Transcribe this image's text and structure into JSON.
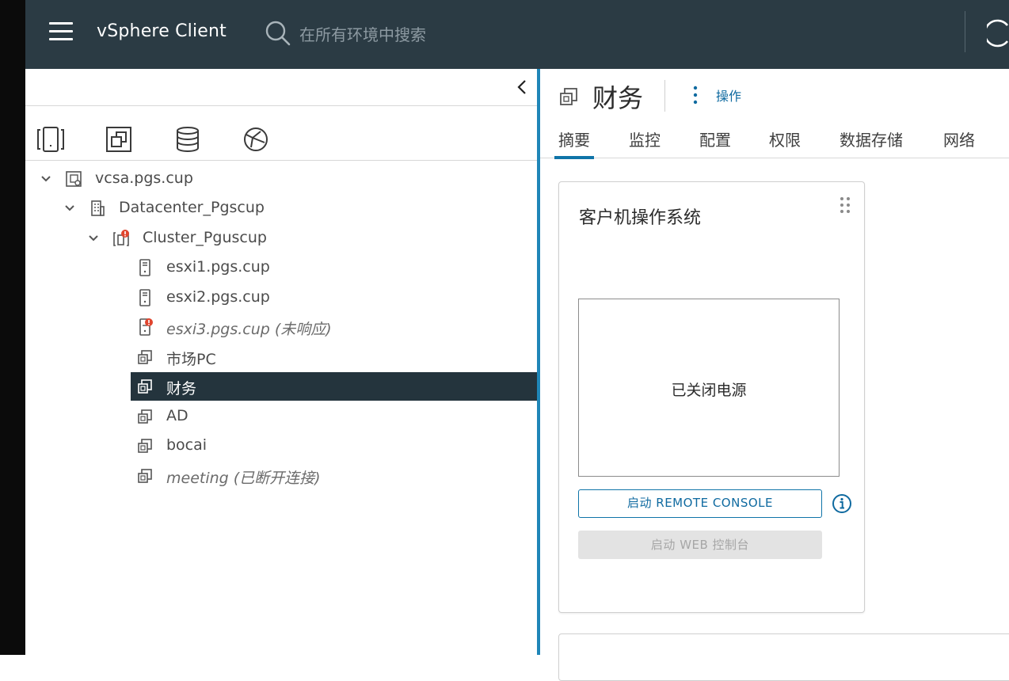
{
  "header": {
    "app_title": "vSphere Client",
    "search_placeholder": "在所有环境中搜索",
    "menu_icon": "hamburger-icon",
    "search_icon": "search-icon"
  },
  "navigator": {
    "tabs": [
      {
        "name": "hosts-and-clusters",
        "icon": "hosts-clusters-icon",
        "active": true
      },
      {
        "name": "vms-and-templates",
        "icon": "vms-templates-icon",
        "active": false
      },
      {
        "name": "storage",
        "icon": "storage-icon",
        "active": false
      },
      {
        "name": "networking",
        "icon": "network-icon",
        "active": false
      }
    ],
    "tree": [
      {
        "label": "vcsa.pgs.cup",
        "type": "vcenter",
        "expanded": true,
        "level": 0
      },
      {
        "label": "Datacenter_Pgscup",
        "type": "datacenter",
        "expanded": true,
        "level": 1
      },
      {
        "label": "Cluster_Pguscup",
        "type": "cluster",
        "expanded": true,
        "level": 2,
        "alert": true
      },
      {
        "label": "esxi1.pgs.cup",
        "type": "host",
        "level": 3
      },
      {
        "label": "esxi2.pgs.cup",
        "type": "host",
        "level": 3
      },
      {
        "label": "esxi3.pgs.cup (未响应)",
        "type": "host",
        "level": 3,
        "alert": true,
        "italic": true
      },
      {
        "label": "市场PC",
        "type": "vm",
        "level": 3
      },
      {
        "label": "财务",
        "type": "vm",
        "level": 3,
        "selected": true
      },
      {
        "label": "AD",
        "type": "vm",
        "level": 3
      },
      {
        "label": "bocai",
        "type": "vm",
        "level": 3
      },
      {
        "label": "meeting (已断开连接)",
        "type": "vm",
        "level": 3,
        "italic": true
      }
    ]
  },
  "object": {
    "title": "财务",
    "actions_label": "操作",
    "tabs": [
      "摘要",
      "监控",
      "配置",
      "权限",
      "数据存储",
      "网络"
    ],
    "active_tab": "摘要"
  },
  "guest_os_card": {
    "title": "客户机操作系统",
    "console_status": "已关闭电源",
    "remote_console_button": "启动 REMOTE CONSOLE",
    "web_console_button": "启动 WEB 控制台"
  },
  "colors": {
    "header_bg": "#2b3b44",
    "accent": "#0f74a8",
    "selected_bg": "#24343d",
    "alert": "#e0452e"
  }
}
